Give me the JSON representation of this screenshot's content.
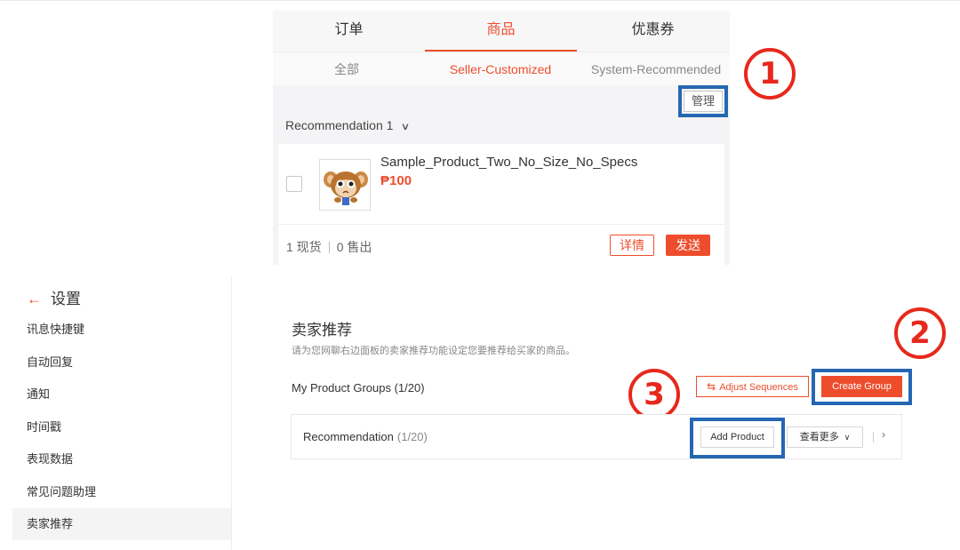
{
  "top_panel": {
    "tabs": [
      "订单",
      "商品",
      "优惠券"
    ],
    "active_tab": 1,
    "subtabs": [
      "全部",
      "Seller-Customized",
      "System-Recommended"
    ],
    "active_subtab": 1,
    "manage_label": "管理",
    "group_header": "Recommendation",
    "group_count": "1",
    "product": {
      "name": "Sample_Product_Two_No_Size_No_Specs",
      "price": "₱100",
      "stock": "1 现货",
      "sold": "0 售出"
    },
    "detail_label": "详情",
    "send_label": "发送"
  },
  "annotations": [
    "1",
    "2",
    "3"
  ],
  "sidebar": {
    "title": "设置",
    "items": [
      "讯息快捷键",
      "自动回复",
      "通知",
      "时间戳",
      "表现数据",
      "常见问题助理",
      "卖家推荐"
    ],
    "active_index": 6
  },
  "main": {
    "title": "卖家推荐",
    "description": "请为您网聊右边面板的卖家推荐功能设定您要推荐给买家的商品。",
    "groups_label": "My Product Groups (1/20)",
    "adjust_label": "Adjust Sequences",
    "create_label": "Create Group",
    "group": {
      "name": "Recommendation",
      "count": "(1/20)",
      "add_label": "Add Product",
      "more_label": "查看更多"
    }
  },
  "colors": {
    "brand": "#ee4d2d",
    "highlight_box": "#2567b3",
    "annotation_red": "#e8281c"
  }
}
